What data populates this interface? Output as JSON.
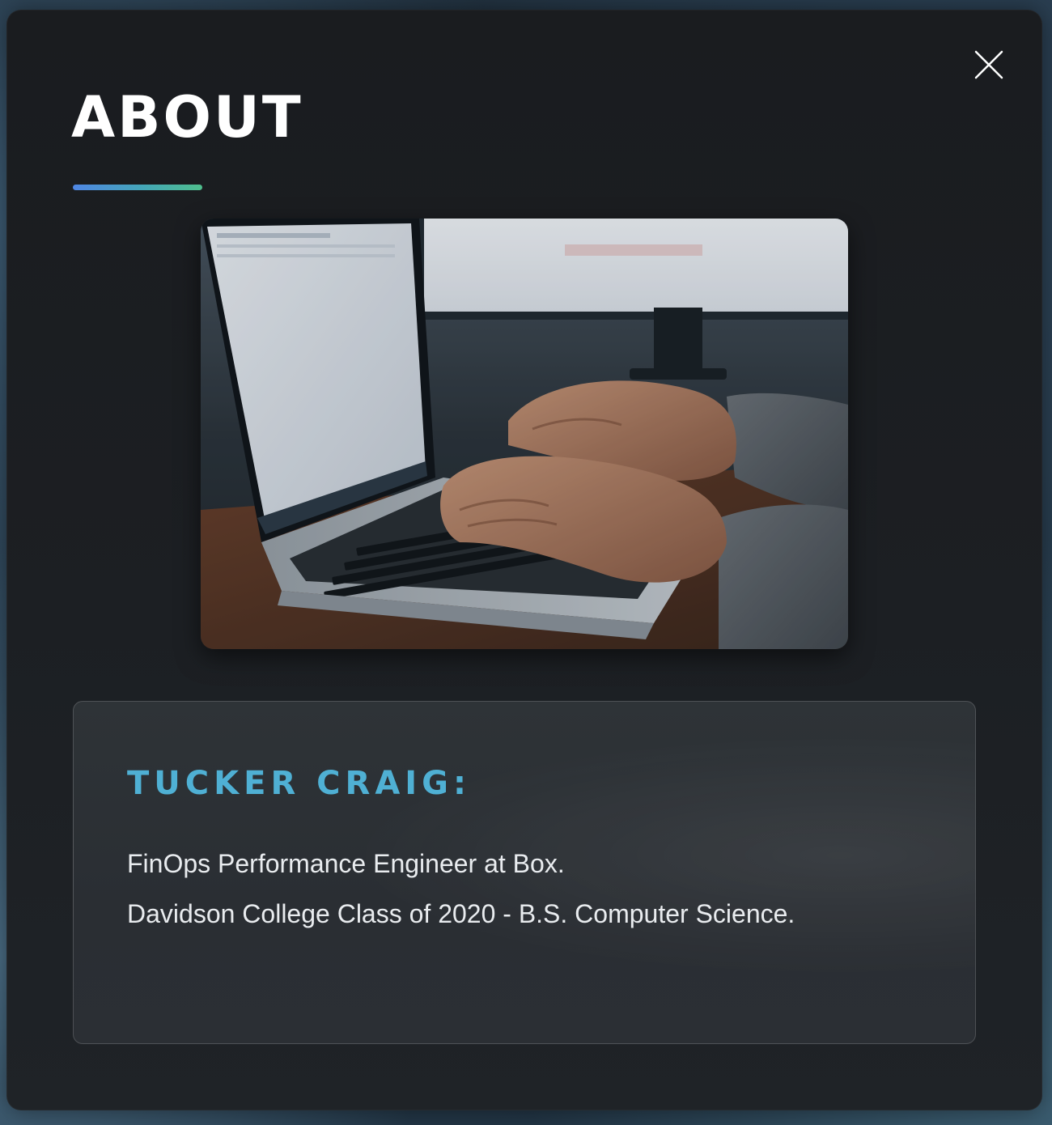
{
  "about": {
    "title": "ABOUT",
    "accent_gradient": [
      "#4f86e4",
      "#44a7b7",
      "#4fbf8d"
    ],
    "close_icon": "close-icon",
    "hero_image": "photo of hands typing on a laptop keyboard with a monitor in the background",
    "profile": {
      "name": "TUCKER CRAIG:",
      "lines": [
        "FinOps Performance Engineer at Box.",
        "Davidson College Class of 2020 - B.S. Computer Science."
      ]
    }
  },
  "colors": {
    "name_accent": "#4fb0d4",
    "modal_bg": "#1a1c1f",
    "card_bg": "#2e3337"
  }
}
